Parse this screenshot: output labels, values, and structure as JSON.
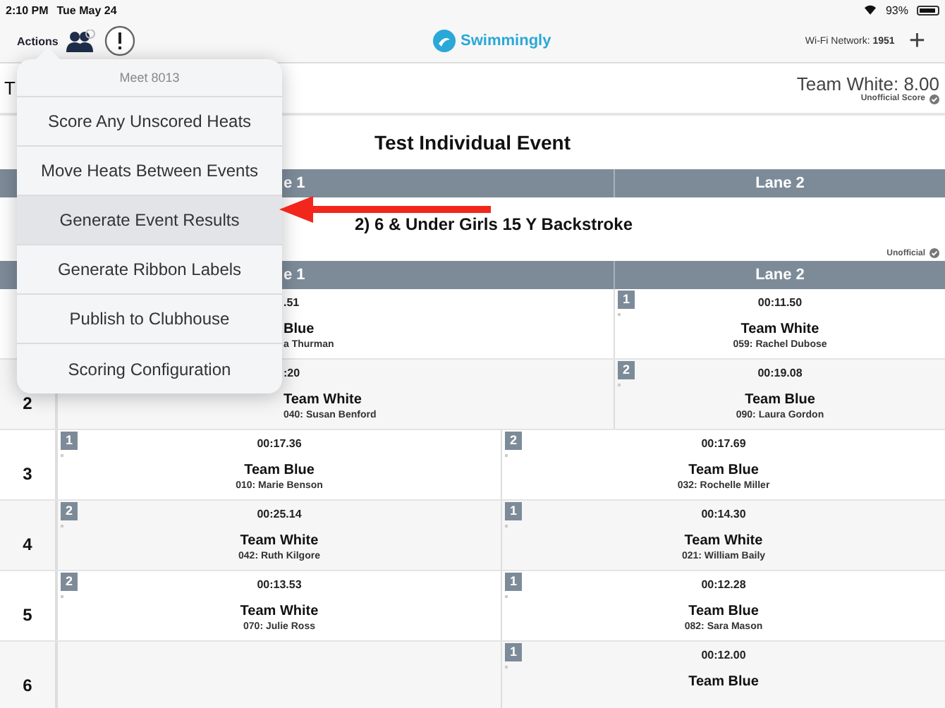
{
  "status_bar": {
    "time": "2:10 PM",
    "date": "Tue May 24",
    "battery": "93%"
  },
  "nav": {
    "actions": "Actions",
    "logo": "Swimmingly",
    "network": "Wi-Fi Network: **1951**",
    "add": "+"
  },
  "score_bar": {
    "left": "T",
    "score": "Team White: 8.00",
    "note": "Unofficial Score"
  },
  "events": [
    {
      "title": "Test Individual Event",
      "columns": [
        {
          "label": "e 1",
          "kind": "covered"
        },
        {
          "label": "Lane 2",
          "kind": "full"
        }
      ]
    },
    {
      "title": "2) 6 & Under Girls 15 Y Backstroke",
      "status": "Unofficial",
      "columns": [
        {
          "label": "e 1",
          "kind": "covered"
        },
        {
          "label": "Lane 2",
          "kind": "full"
        }
      ],
      "rows": [
        {
          "results": [
            {
              "kind": "covered",
              "time": ".51",
              "team": "Blue",
              "swimmer": "a Thurman"
            },
            {
              "kind": "full",
              "place": "1",
              "time": "00:11.50",
              "team": "Team White",
              "swimmer": "059: Rachel Dubose"
            }
          ]
        },
        {
          "lane": "2",
          "results": [
            {
              "kind": "covered",
              "time": ":20",
              "team": "Team White",
              "swimmer": "040: Susan Benford"
            },
            {
              "kind": "full",
              "place": "2",
              "time": "00:19.08",
              "team": "Team Blue",
              "swimmer": "090: Laura Gordon"
            }
          ]
        },
        {
          "lane": "3",
          "results": [
            {
              "kind": "full",
              "place": "1",
              "time": "00:17.36",
              "team": "Team Blue",
              "swimmer": "010: Marie Benson"
            },
            {
              "kind": "full",
              "place": "2",
              "time": "00:17.69",
              "team": "Team Blue",
              "swimmer": "032: Rochelle Miller"
            }
          ]
        },
        {
          "lane": "4",
          "results": [
            {
              "kind": "full",
              "place": "2",
              "time": "00:25.14",
              "team": "Team White",
              "swimmer": "042: Ruth Kilgore"
            },
            {
              "kind": "full",
              "place": "1",
              "time": "00:14.30",
              "team": "Team White",
              "swimmer": "021: William Baily"
            }
          ]
        },
        {
          "lane": "5",
          "results": [
            {
              "kind": "full",
              "place": "2",
              "time": "00:13.53",
              "team": "Team White",
              "swimmer": "070: Julie Ross"
            },
            {
              "kind": "full",
              "place": "1",
              "time": "00:12.28",
              "team": "Team Blue",
              "swimmer": "082: Sara Mason"
            }
          ]
        },
        {
          "lane": "6",
          "results": [
            {
              "kind": "empty"
            },
            {
              "kind": "full",
              "place": "1",
              "time": "00:12.00",
              "team": "Team Blue"
            }
          ]
        }
      ]
    }
  ],
  "menu": {
    "title": "Meet 8013",
    "items": [
      {
        "label": "Score Any Unscored Heats",
        "selected": false
      },
      {
        "label": "Move Heats Between Events",
        "selected": false
      },
      {
        "label": "Generate Event Results",
        "selected": true
      },
      {
        "label": "Generate Ribbon Labels",
        "selected": false
      },
      {
        "label": "Publish to Clubhouse",
        "selected": false
      },
      {
        "label": "Scoring Configuration",
        "selected": false
      }
    ]
  }
}
